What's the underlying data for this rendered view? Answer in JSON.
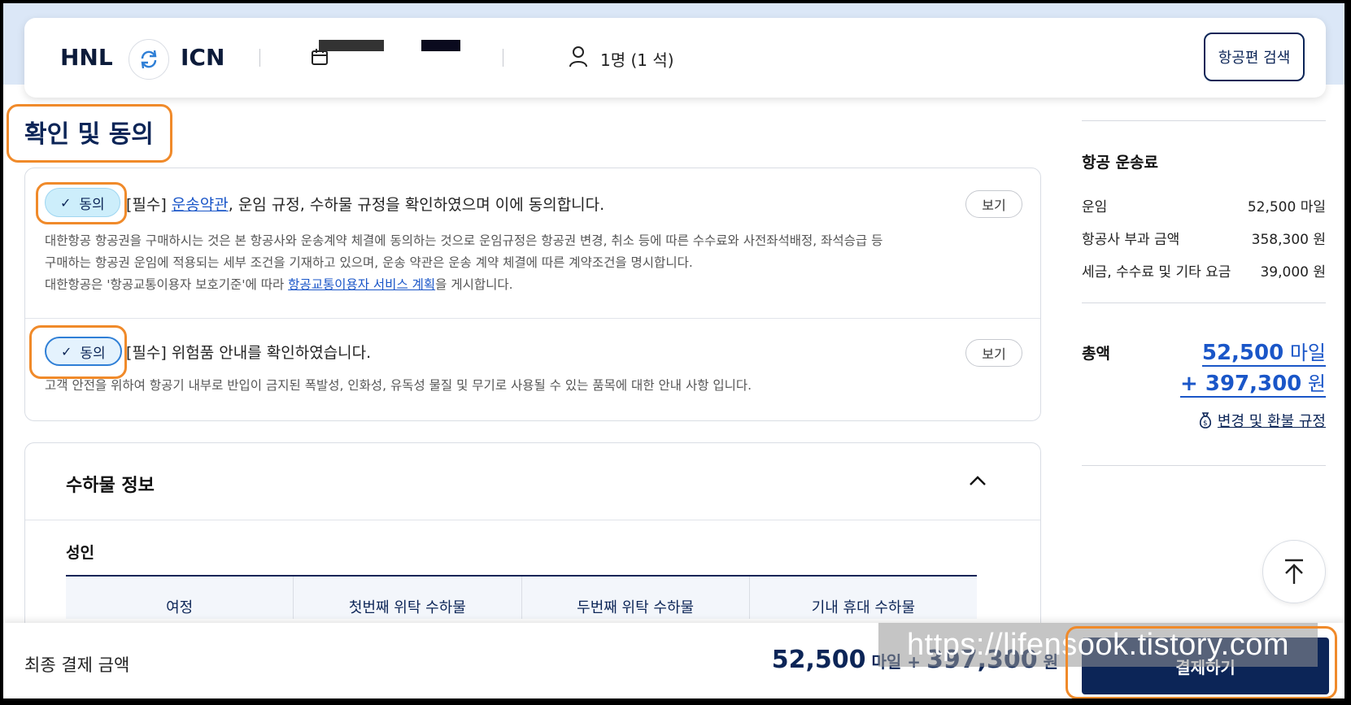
{
  "search": {
    "origin": "HNL",
    "destination": "ICN",
    "passengers": "1명 (1 석)",
    "search_button": "항공편 검색"
  },
  "consent": {
    "title": "확인 및 동의",
    "items": [
      {
        "agree_label": "동의",
        "req_prefix": "[필수] ",
        "link_text": "운송약관",
        "req_suffix": ", 운임 규정, 수하물 규정을 확인하였으며 이에 동의합니다.",
        "view_label": "보기",
        "desc_line1": "대한항공 항공권을 구매하시는 것은 본 항공사와 운송계약 체결에 동의하는 것으로 운임규정은 항공권 변경, 취소 등에 따른 수수료와 사전좌석배정, 좌석승급 등",
        "desc_line2": "구매하는 항공권 운임에 적용되는 세부 조건을 기재하고 있으며, 운송 약관은 운송 계약 체결에 따른 계약조건을 명시합니다.",
        "desc_line3_prefix": "대한항공은 '항공교통이용자 보호기준'에 따라 ",
        "desc_line3_link": "항공교통이용자 서비스 계획",
        "desc_line3_suffix": "을 게시합니다."
      },
      {
        "agree_label": "동의",
        "req_text": "[필수] 위험품 안내를 확인하였습니다.",
        "view_label": "보기",
        "desc": "고객 안전을 위하여 항공기 내부로 반입이 금지된 폭발성, 인화성, 유독성 물질 및 무기로 사용될 수 있는 품목에 대한 안내 사항 입니다."
      }
    ]
  },
  "baggage": {
    "title": "수하물 정보",
    "passenger_type": "성인",
    "columns": [
      "여정",
      "첫번째 위탁 수하물",
      "두번째 위탁 수하물",
      "기내 휴대 수하물"
    ]
  },
  "fare": {
    "title": "항공 운송료",
    "rows": [
      {
        "label": "운임",
        "value": "52,500 마일"
      },
      {
        "label": "항공사 부과 금액",
        "value": "358,300 원"
      },
      {
        "label": "세금, 수수료 및 기타 요금",
        "value": "39,000 원"
      }
    ],
    "total_label": "총액",
    "total_miles": "52,500",
    "total_miles_unit": " 마일",
    "total_won": "+ 397,300",
    "total_won_unit": " 원",
    "refund_link": "변경 및 환불 규정"
  },
  "footer": {
    "final_label": "최종 결제 금액",
    "miles": "52,500",
    "miles_unit": " 마일",
    "plus": " + ",
    "won": "397,300",
    "won_unit": " 원",
    "pay_button": "결제하기"
  },
  "watermark": "https://lifensook.tistory.com",
  "colors": {
    "navy": "#0c2557",
    "link_blue": "#1a56c8",
    "agree_bg": "#cdeefb",
    "annotation_orange": "#f08a2a"
  }
}
